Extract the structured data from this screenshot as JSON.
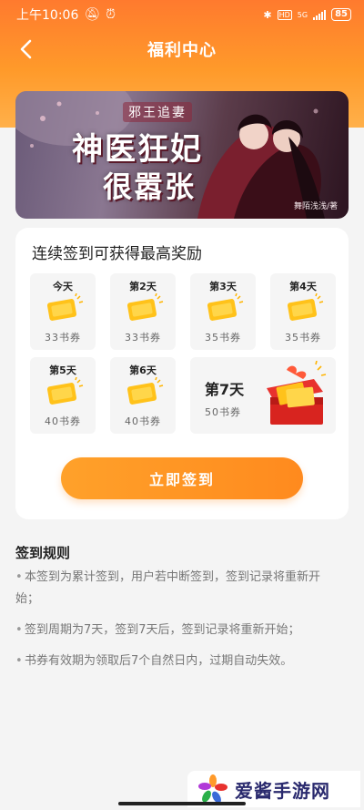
{
  "status_bar": {
    "time": "上午10:06",
    "network": "5G",
    "battery": "85"
  },
  "nav": {
    "title": "福利中心"
  },
  "banner": {
    "tag": "邪王追妻",
    "title_line1": "神医狂妃",
    "title_line2": "很嚣张",
    "author": "舞陌浅浅/著"
  },
  "signin": {
    "title": "连续签到可获得最高奖励",
    "days": [
      {
        "label": "今天",
        "reward": "33书券"
      },
      {
        "label": "第2天",
        "reward": "33书券"
      },
      {
        "label": "第3天",
        "reward": "35书券"
      },
      {
        "label": "第4天",
        "reward": "35书券"
      },
      {
        "label": "第5天",
        "reward": "40书券"
      },
      {
        "label": "第6天",
        "reward": "40书券"
      }
    ],
    "day7": {
      "label": "第7天",
      "reward": "50书券"
    },
    "button_label": "立即签到"
  },
  "rules": {
    "title": "签到规则",
    "items": [
      "本签到为累计签到，用户若中断签到，签到记录将重新开始；",
      "签到周期为7天，签到7天后，签到记录将重新开始；",
      "书券有效期为领取后7个自然日内，过期自动失效。"
    ]
  },
  "watermark": {
    "text": "爱酱手游网"
  },
  "colors": {
    "accent": "#ff8a1e",
    "header_top": "#ff7a2e",
    "ticket": "#ffc21a"
  }
}
